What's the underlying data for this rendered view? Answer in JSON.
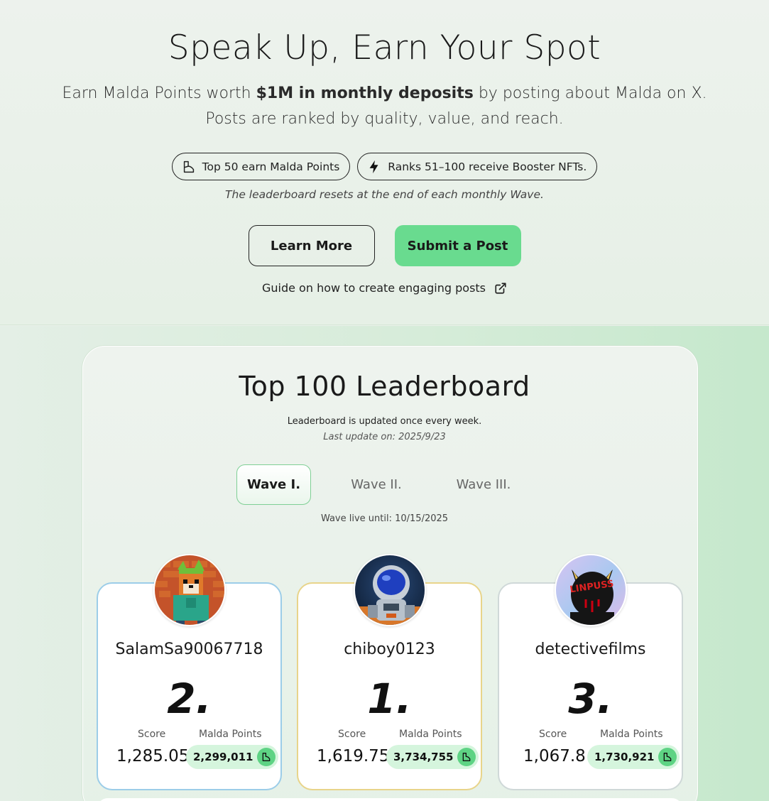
{
  "hero": {
    "title": "Speak Up, Earn Your Spot",
    "sub_prefix": "Earn Malda Points worth ",
    "sub_bold": "$1M in monthly deposits",
    "sub_suffix": " by posting about Malda on X.",
    "sub_line2": "Posts are ranked by quality, value, and reach.",
    "pill_1": "Top 50 earn Malda Points",
    "pill_2": "Ranks 51–100 receive Booster NFTs.",
    "reset_note": "The leaderboard resets at the end of each monthly Wave.",
    "learn_more": "Learn More",
    "submit_post": "Submit a Post",
    "guide": "Guide on how to create engaging posts"
  },
  "leaderboard": {
    "title": "Top 100 Leaderboard",
    "note": "Leaderboard is updated once every week.",
    "last_update": "Last update on: 2025/9/23",
    "tabs": [
      "Wave I.",
      "Wave II.",
      "Wave III."
    ],
    "active_tab": "Wave I.",
    "wave_live": "Wave live until: 10/15/2025",
    "score_label": "Score",
    "points_label": "Malda Points",
    "podium": [
      {
        "username": "SalamSa90067718",
        "rank": "2.",
        "score": "1,285.05",
        "points": "2,299,011"
      },
      {
        "username": "chiboy0123",
        "rank": "1.",
        "score": "1,619.75",
        "points": "3,734,755"
      },
      {
        "username": "detectivefilms",
        "rank": "3.",
        "score": "1,067.8",
        "points": "1,730,921"
      }
    ]
  },
  "colors": {
    "accent_green": "#69db8f",
    "badge_bg": "#d5f5dd",
    "second_border": "#9ccde8",
    "first_border": "#e8d48a",
    "third_border": "#cfd8d8"
  },
  "icons": {
    "pill_1": "malda-leaf-icon",
    "pill_2": "lightning-icon",
    "guide": "external-link-icon",
    "points": "malda-leaf-icon"
  }
}
